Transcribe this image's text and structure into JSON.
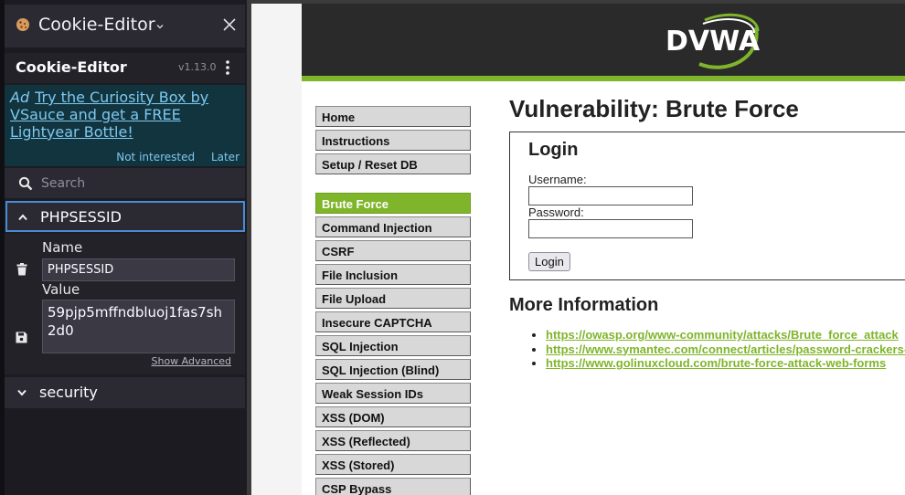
{
  "extension": {
    "header_title": "Cookie-Editor",
    "name": "Cookie-Editor",
    "version": "v1.13.0",
    "ad": {
      "tag": "Ad",
      "text": "Try the Curiosity Box by VSauce and get a FREE Lightyear Bottle!",
      "not_interested": "Not interested",
      "later": "Later"
    },
    "search_placeholder": "Search",
    "cookies": [
      {
        "name": "PHPSESSID",
        "expanded": true
      },
      {
        "name": "security",
        "expanded": false
      }
    ],
    "editor": {
      "name_label": "Name",
      "name_value": "PHPSESSID",
      "value_label": "Value",
      "value_value": "59pjp5mffndbluoj1fas7sh2d0",
      "show_advanced": "Show Advanced"
    },
    "colors": {
      "accent": "#4a8bd8",
      "ad_background": "#12343f",
      "ad_link": "#7ec8ee"
    }
  },
  "dvwa": {
    "logo_text": "DVWA",
    "menu": [
      {
        "label": "Home",
        "active": false
      },
      {
        "label": "Instructions",
        "active": false
      },
      {
        "label": "Setup / Reset DB",
        "active": false
      },
      {
        "label": "Brute Force",
        "active": true
      },
      {
        "label": "Command Injection",
        "active": false
      },
      {
        "label": "CSRF",
        "active": false
      },
      {
        "label": "File Inclusion",
        "active": false
      },
      {
        "label": "File Upload",
        "active": false
      },
      {
        "label": "Insecure CAPTCHA",
        "active": false
      },
      {
        "label": "SQL Injection",
        "active": false
      },
      {
        "label": "SQL Injection (Blind)",
        "active": false
      },
      {
        "label": "Weak Session IDs",
        "active": false
      },
      {
        "label": "XSS (DOM)",
        "active": false
      },
      {
        "label": "XSS (Reflected)",
        "active": false
      },
      {
        "label": "XSS (Stored)",
        "active": false
      },
      {
        "label": "CSP Bypass",
        "active": false
      }
    ],
    "page_title": "Vulnerability: Brute Force",
    "login": {
      "heading": "Login",
      "username_label": "Username:",
      "username_value": "",
      "password_label": "Password:",
      "password_value": "",
      "button": "Login"
    },
    "more_info_heading": "More Information",
    "links": [
      "https://owasp.org/www-community/attacks/Brute_force_attack",
      "https://www.symantec.com/connect/articles/password-crackers-ensuring-security-your-password",
      "https://www.golinuxcloud.com/brute-force-attack-web-forms"
    ],
    "colors": {
      "accent": "#7fb52a",
      "header": "#2a2a2a"
    }
  }
}
